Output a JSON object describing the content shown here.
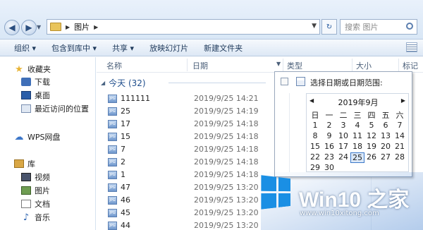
{
  "address": {
    "crumb": "图片",
    "search_placeholder": "搜索 图片"
  },
  "toolbar": {
    "organize": "组织 ▾",
    "include_library": "包含到库中 ▾",
    "share": "共享 ▾",
    "slideshow": "放映幻灯片",
    "new_folder": "新建文件夹"
  },
  "nav": {
    "favorites": "收藏夹",
    "downloads": "下载",
    "desktop": "桌面",
    "recent": "最近访问的位置",
    "wps": "WPS网盘",
    "library": "库",
    "videos": "视频",
    "pictures": "图片",
    "documents": "文档",
    "music": "音乐"
  },
  "columns": {
    "name": "名称",
    "date": "日期",
    "type": "类型",
    "size": "大小",
    "tags": "标记"
  },
  "group": {
    "label": "今天 (32)"
  },
  "files": [
    {
      "name": "111111",
      "date": "2019/9/25 14:21"
    },
    {
      "name": "25",
      "date": "2019/9/25 14:19"
    },
    {
      "name": "17",
      "date": "2019/9/25 14:18"
    },
    {
      "name": "15",
      "date": "2019/9/25 14:18"
    },
    {
      "name": "7",
      "date": "2019/9/25 14:18"
    },
    {
      "name": "2",
      "date": "2019/9/25 14:18"
    },
    {
      "name": "1",
      "date": "2019/9/25 14:18"
    },
    {
      "name": "47",
      "date": "2019/9/25 13:20"
    },
    {
      "name": "46",
      "date": "2019/9/25 13:20"
    },
    {
      "name": "45",
      "date": "2019/9/25 13:20"
    },
    {
      "name": "44",
      "date": "2019/9/25 13:20"
    }
  ],
  "date_filter": {
    "title": "选择日期或日期范围:",
    "month": "2019年9月",
    "weekdays": [
      "日",
      "一",
      "二",
      "三",
      "四",
      "五",
      "六"
    ],
    "weeks": [
      [
        "1",
        "2",
        "3",
        "4",
        "5",
        "6",
        "7"
      ],
      [
        "8",
        "9",
        "10",
        "11",
        "12",
        "13",
        "14"
      ],
      [
        "15",
        "16",
        "17",
        "18",
        "19",
        "20",
        "21"
      ],
      [
        "22",
        "23",
        "24",
        "25",
        "26",
        "27",
        "28"
      ],
      [
        "29",
        "30",
        "",
        "",
        "",
        "",
        ""
      ]
    ],
    "selected_day": "25"
  },
  "watermark": {
    "title": "Win10 之家",
    "site": "www.win10xitong.com",
    "logo_color": "#1a8fe4"
  }
}
